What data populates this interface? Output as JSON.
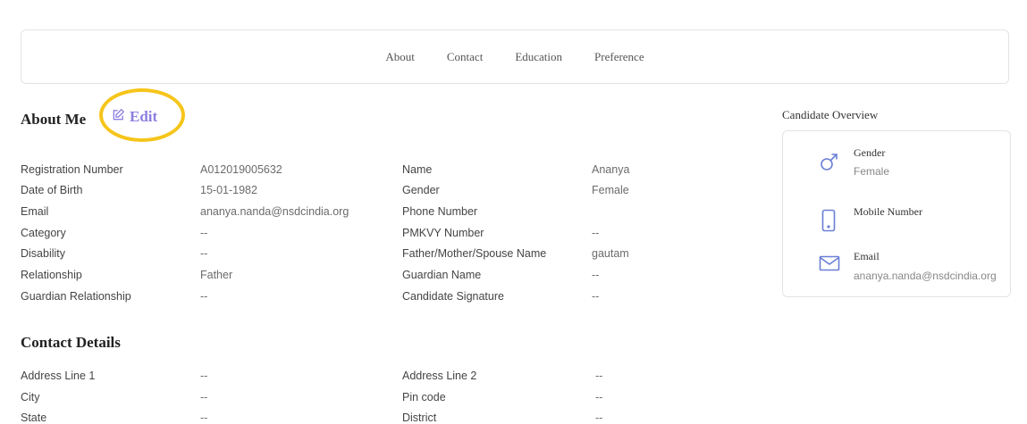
{
  "tabs": [
    {
      "label": "About"
    },
    {
      "label": "Contact"
    },
    {
      "label": "Education"
    },
    {
      "label": "Preference"
    }
  ],
  "about": {
    "title": "About Me",
    "edit_label": "Edit",
    "left": [
      {
        "label": "Registration Number",
        "value": "A012019005632"
      },
      {
        "label": "Date of Birth",
        "value": "15-01-1982"
      },
      {
        "label": "Email",
        "value": "ananya.nanda@nsdcindia.org"
      },
      {
        "label": "Category",
        "value": "--"
      },
      {
        "label": "Disability",
        "value": "--"
      },
      {
        "label": "Relationship",
        "value": "Father"
      },
      {
        "label": "Guardian Relationship",
        "value": "--"
      }
    ],
    "right": [
      {
        "label": "Name",
        "value": "Ananya"
      },
      {
        "label": "Gender",
        "value": "Female"
      },
      {
        "label": "Phone Number",
        "value": ""
      },
      {
        "label": "PMKVY Number",
        "value": "--"
      },
      {
        "label": "Father/Mother/Spouse Name",
        "value": "gautam"
      },
      {
        "label": "Guardian Name",
        "value": "--"
      },
      {
        "label": "Candidate Signature",
        "value": "--"
      }
    ]
  },
  "contact": {
    "title": "Contact Details",
    "left": [
      {
        "label": "Address Line 1",
        "value": "--"
      },
      {
        "label": "City",
        "value": "--"
      },
      {
        "label": "State",
        "value": "--"
      }
    ],
    "right": [
      {
        "label": "Address Line 2",
        "value": "--"
      },
      {
        "label": "Pin code",
        "value": "--"
      },
      {
        "label": "District",
        "value": "--"
      }
    ]
  },
  "overview": {
    "title": "Candidate Overview",
    "gender_label": "Gender",
    "gender_value": "Female",
    "mobile_label": "Mobile Number",
    "email_label": "Email",
    "email_value": "ananya.nanda@nsdcindia.org",
    "icon_color": "#6a7fd6"
  },
  "colors": {
    "accent": "#8b7ee0",
    "highlight": "#f6c51b"
  }
}
